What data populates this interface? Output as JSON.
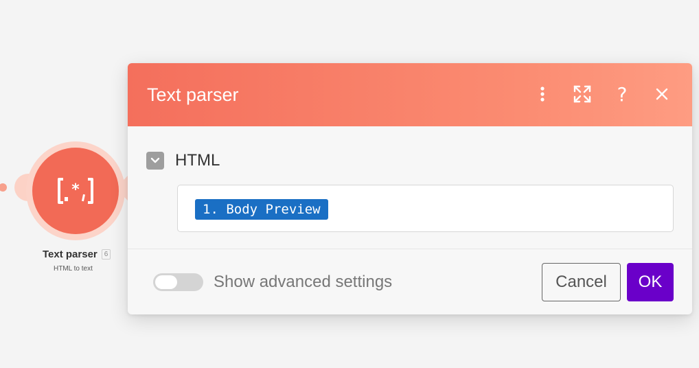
{
  "module": {
    "name": "Text parser",
    "badge": "6",
    "subtitle": "HTML to text",
    "icon": "regex-brackets-icon",
    "icon_text": "[.*]",
    "color": "#f26a56"
  },
  "dialog": {
    "title": "Text parser",
    "header_icons": [
      "more-vertical-icon",
      "expand-icon",
      "help-icon",
      "close-icon"
    ],
    "help_glyph": "?",
    "close_glyph": "✕",
    "field": {
      "label": "HTML",
      "value_pill": "1. Body Preview"
    },
    "footer": {
      "advanced_label": "Show advanced settings",
      "advanced_enabled": false,
      "cancel_label": "Cancel",
      "ok_label": "OK"
    }
  },
  "colors": {
    "header_start": "#f46f5c",
    "header_end": "#fe9c82",
    "pill": "#1a6fc4",
    "ok_button": "#6a00c9"
  }
}
